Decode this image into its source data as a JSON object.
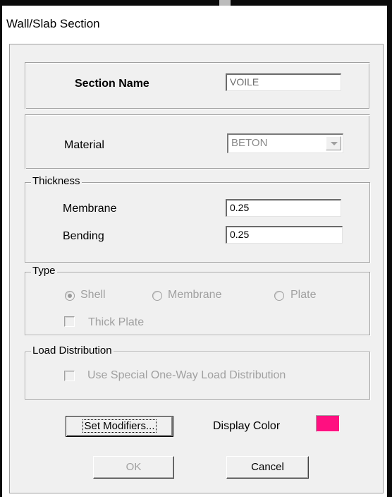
{
  "window": {
    "title": "Wall/Slab Section"
  },
  "section": {
    "label": "Section Name",
    "value": "VOILE"
  },
  "material": {
    "label": "Material",
    "value": "BETON"
  },
  "thickness": {
    "legend": "Thickness",
    "membrane_label": "Membrane",
    "membrane_value": "0.25",
    "bending_label": "Bending",
    "bending_value": "0.25"
  },
  "type": {
    "legend": "Type",
    "options": [
      "Shell",
      "Membrane",
      "Plate"
    ],
    "selected": "Shell",
    "thick_plate_label": "Thick Plate",
    "thick_plate_checked": false
  },
  "load_distribution": {
    "legend": "Load Distribution",
    "checkbox_label": "Use Special One-Way Load Distribution",
    "checked": false
  },
  "buttons": {
    "set_modifiers": "Set Modifiers...",
    "ok": "OK",
    "cancel": "Cancel"
  },
  "display_color": {
    "label": "Display Color",
    "value": "#ff0f80"
  }
}
